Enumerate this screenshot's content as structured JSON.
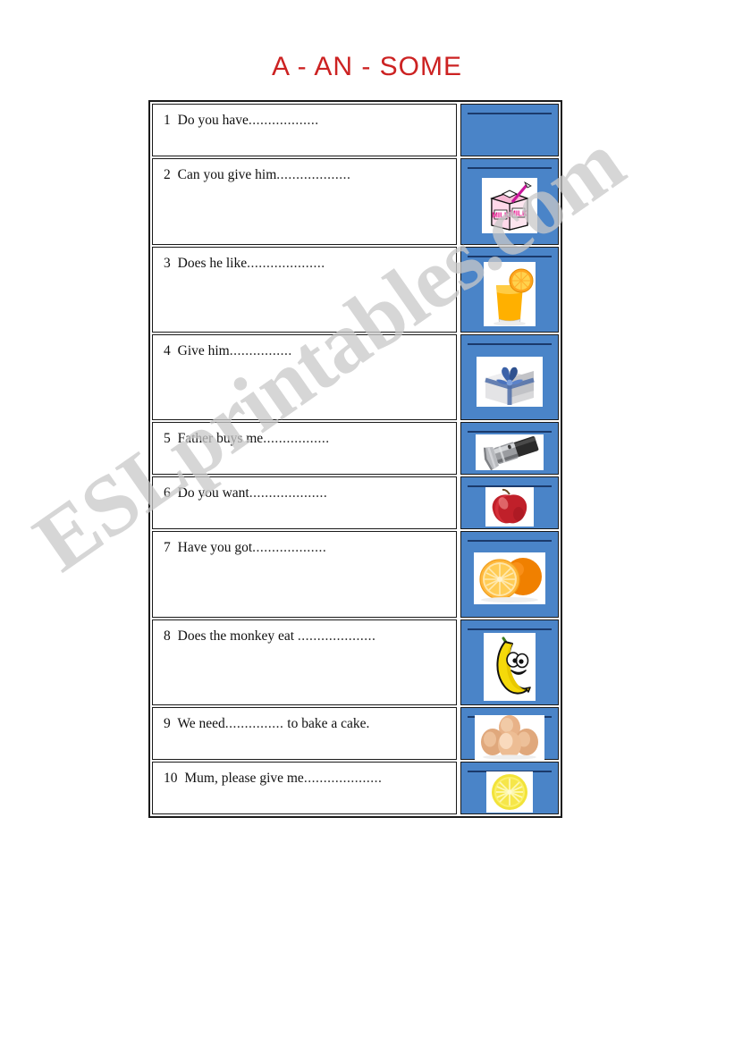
{
  "document": {
    "title": "A - AN - SOME",
    "watermark": "ESLprintables.com",
    "accent_red": "#cc2222",
    "picture_cell_blue": "#4a84c8",
    "rule_navy": "#1b3a6b"
  },
  "exercise": {
    "rows": [
      {
        "number": "1",
        "prompt": "Do you have",
        "dots": "..................",
        "tail": "",
        "picture": "none",
        "picture_label": ""
      },
      {
        "number": "2",
        "prompt": "Can you give him",
        "dots": "...................",
        "tail": "",
        "picture": "milk-carton-icon",
        "picture_label": "MILK"
      },
      {
        "number": "3",
        "prompt": "Does he like",
        "dots": "....................",
        "tail": "",
        "picture": "orange-juice-glass-icon",
        "picture_label": ""
      },
      {
        "number": "4",
        "prompt": "Give him",
        "dots": "................",
        "tail": "",
        "picture": "gift-box-icon",
        "picture_label": ""
      },
      {
        "number": "5",
        "prompt": "Father buys me",
        "dots": ".................",
        "tail": "",
        "picture": "flashlight-icon",
        "picture_label": ""
      },
      {
        "number": "6",
        "prompt": "Do you want",
        "dots": "....................",
        "tail": "",
        "picture": "apple-icon",
        "picture_label": ""
      },
      {
        "number": "7",
        "prompt": "Have you got",
        "dots": "...................",
        "tail": "",
        "picture": "orange-fruit-icon",
        "picture_label": ""
      },
      {
        "number": "8",
        "prompt": "Does the monkey eat ",
        "dots": "....................",
        "tail": "",
        "picture": "banana-cartoon-icon",
        "picture_label": ""
      },
      {
        "number": "9",
        "prompt": "We need",
        "dots": "...............",
        "tail": " to bake a cake.",
        "picture": "eggs-icon",
        "picture_label": ""
      },
      {
        "number": "10",
        "prompt": "Mum, please give me",
        "dots": "....................",
        "tail": "",
        "picture": "lemon-slice-icon",
        "picture_label": ""
      }
    ]
  }
}
